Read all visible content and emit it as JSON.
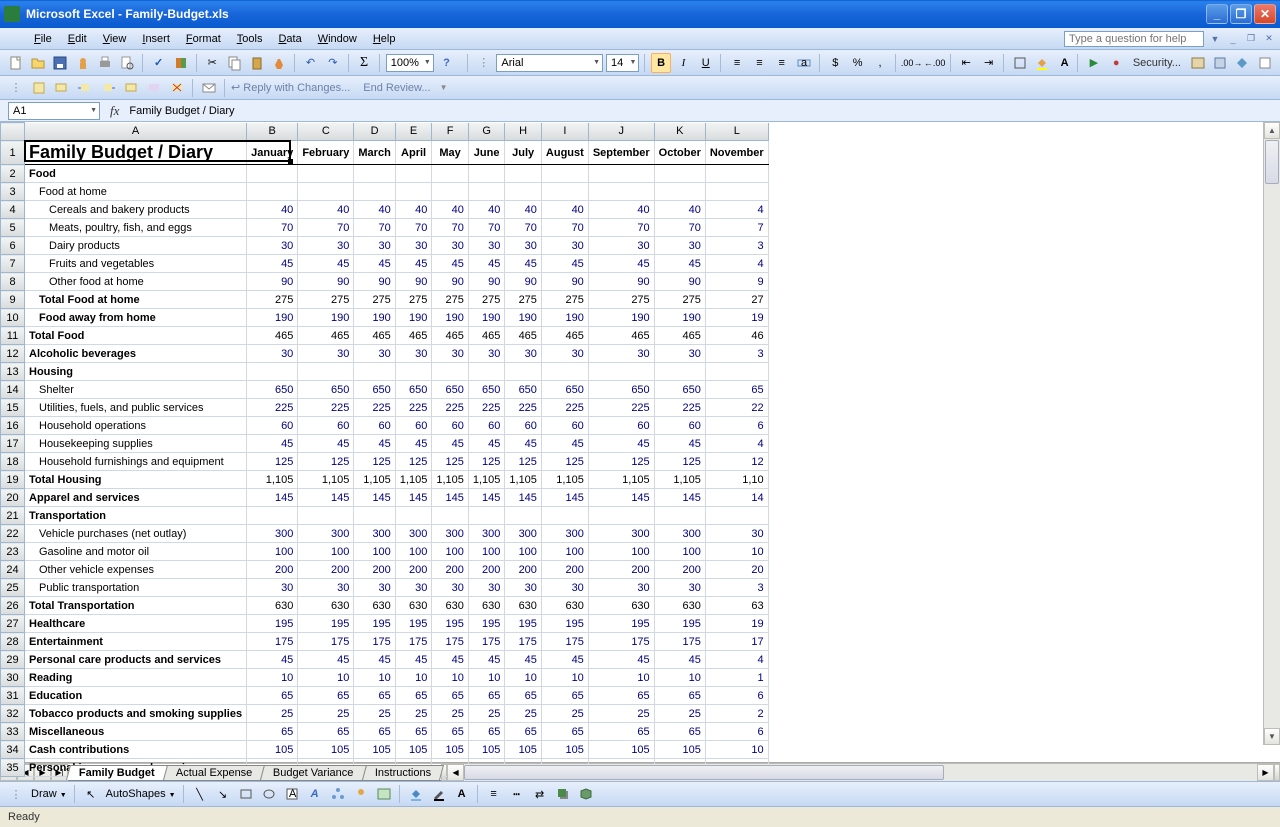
{
  "window": {
    "title": "Microsoft Excel - Family-Budget.xls"
  },
  "menu": {
    "items": [
      "File",
      "Edit",
      "View",
      "Insert",
      "Format",
      "Tools",
      "Data",
      "Window",
      "Help"
    ],
    "helpPlaceholder": "Type a question for help"
  },
  "toolbar": {
    "zoom": "100%",
    "font": "Arial",
    "fontSize": "14",
    "security": "Security..."
  },
  "review": {
    "reply": "Reply with Changes...",
    "end": "End Review..."
  },
  "namebox": {
    "ref": "A1",
    "fxLabel": "fx",
    "formula": "Family Budget / Diary"
  },
  "columns": [
    "A",
    "B",
    "C",
    "D",
    "E",
    "F",
    "G",
    "H",
    "I",
    "J",
    "K",
    "L"
  ],
  "months": [
    "January",
    "February",
    "March",
    "April",
    "May",
    "June",
    "July",
    "August",
    "September",
    "October",
    "November"
  ],
  "title": "Family Budget / Diary",
  "rows": [
    {
      "n": 2,
      "label": "Food",
      "class": "boldlbl"
    },
    {
      "n": 3,
      "label": "Food at home",
      "class": "indent1"
    },
    {
      "n": 4,
      "label": "Cereals and bakery products",
      "class": "indent2",
      "val": "40",
      "last": "4"
    },
    {
      "n": 5,
      "label": "Meats, poultry, fish, and eggs",
      "class": "indent2",
      "val": "70",
      "last": "7"
    },
    {
      "n": 6,
      "label": "Dairy products",
      "class": "indent2",
      "val": "30",
      "last": "3"
    },
    {
      "n": 7,
      "label": "Fruits and vegetables",
      "class": "indent2",
      "val": "45",
      "last": "4"
    },
    {
      "n": 8,
      "label": "Other food at home",
      "class": "indent2",
      "val": "90",
      "last": "9"
    },
    {
      "n": 9,
      "label": "Total Food at home",
      "class": "indent1 boldlbl black",
      "val": "275",
      "black": true,
      "last": "27"
    },
    {
      "n": 10,
      "label": "Food away from home",
      "class": "indent1 boldlbl",
      "val": "190",
      "last": "19"
    },
    {
      "n": 11,
      "label": "Total Food",
      "class": "boldlbl black",
      "val": "465",
      "black": true,
      "last": "46"
    },
    {
      "n": 12,
      "label": "Alcoholic beverages",
      "class": "boldlbl",
      "val": "30",
      "last": "3"
    },
    {
      "n": 13,
      "label": "Housing",
      "class": "boldlbl"
    },
    {
      "n": 14,
      "label": "Shelter",
      "class": "indent1",
      "val": "650",
      "last": "65"
    },
    {
      "n": 15,
      "label": "Utilities, fuels, and public services",
      "class": "indent1",
      "val": "225",
      "last": "22"
    },
    {
      "n": 16,
      "label": "Household operations",
      "class": "indent1",
      "val": "60",
      "last": "6"
    },
    {
      "n": 17,
      "label": "Housekeeping supplies",
      "class": "indent1",
      "val": "45",
      "last": "4"
    },
    {
      "n": 18,
      "label": "Household furnishings and equipment",
      "class": "indent1",
      "val": "125",
      "last": "12"
    },
    {
      "n": 19,
      "label": "Total Housing",
      "class": "boldlbl black",
      "val": "1,105",
      "black": true,
      "last": "1,10"
    },
    {
      "n": 20,
      "label": "Apparel and services",
      "class": "boldlbl",
      "val": "145",
      "last": "14"
    },
    {
      "n": 21,
      "label": "Transportation",
      "class": "boldlbl"
    },
    {
      "n": 22,
      "label": "Vehicle purchases (net outlay)",
      "class": "indent1",
      "val": "300",
      "last": "30"
    },
    {
      "n": 23,
      "label": "Gasoline and motor oil",
      "class": "indent1",
      "val": "100",
      "last": "10"
    },
    {
      "n": 24,
      "label": "Other vehicle expenses",
      "class": "indent1",
      "val": "200",
      "last": "20"
    },
    {
      "n": 25,
      "label": "Public transportation",
      "class": "indent1",
      "val": "30",
      "last": "3"
    },
    {
      "n": 26,
      "label": "Total Transportation",
      "class": "boldlbl black",
      "val": "630",
      "black": true,
      "last": "63"
    },
    {
      "n": 27,
      "label": "Healthcare",
      "class": "boldlbl",
      "val": "195",
      "last": "19"
    },
    {
      "n": 28,
      "label": "Entertainment",
      "class": "boldlbl",
      "val": "175",
      "last": "17"
    },
    {
      "n": 29,
      "label": "Personal care products and services",
      "class": "boldlbl",
      "val": "45",
      "last": "4"
    },
    {
      "n": 30,
      "label": "Reading",
      "class": "boldlbl",
      "val": "10",
      "last": "1"
    },
    {
      "n": 31,
      "label": "Education",
      "class": "boldlbl",
      "val": "65",
      "last": "6"
    },
    {
      "n": 32,
      "label": "Tobacco products and smoking supplies",
      "class": "boldlbl",
      "val": "25",
      "last": "2"
    },
    {
      "n": 33,
      "label": "Miscellaneous",
      "class": "boldlbl",
      "val": "65",
      "last": "6"
    },
    {
      "n": 34,
      "label": "Cash contributions",
      "class": "boldlbl",
      "val": "105",
      "last": "10"
    },
    {
      "n": 35,
      "label": "Personal insurance and pensions",
      "class": "boldlbl"
    }
  ],
  "tabs": {
    "nav": [
      "|◀",
      "◀",
      "▶",
      "▶|"
    ],
    "items": [
      "Family Budget",
      "Actual Expense",
      "Budget Variance",
      "Instructions"
    ],
    "active": 0
  },
  "draw": {
    "label": "Draw",
    "autoshapes": "AutoShapes"
  },
  "status": {
    "text": "Ready"
  }
}
